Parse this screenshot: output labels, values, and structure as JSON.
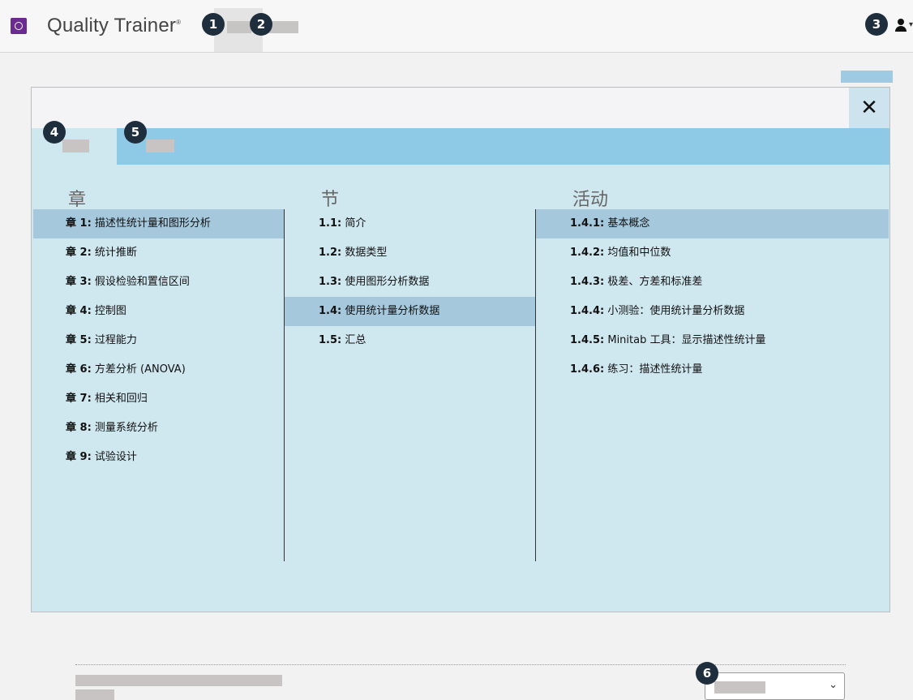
{
  "header": {
    "app_name": "Quality Trainer",
    "registered_mark": "®"
  },
  "callouts": [
    "1",
    "2",
    "3",
    "4",
    "5",
    "6"
  ],
  "icons": {
    "logo": "play-circle-icon",
    "user": "user-icon",
    "close": "close-icon",
    "dropdown": "chevron-down-icon"
  },
  "panel": {
    "close_label": "✕",
    "columns": {
      "chapters": {
        "heading": "章",
        "items": [
          {
            "num": "章 1:",
            "text": " 描述性统计量和图形分析",
            "selected": true
          },
          {
            "num": "章 2:",
            "text": " 统计推断",
            "selected": false
          },
          {
            "num": "章 3:",
            "text": " 假设检验和置信区间",
            "selected": false
          },
          {
            "num": "章 4:",
            "text": " 控制图",
            "selected": false
          },
          {
            "num": "章 5:",
            "text": " 过程能力",
            "selected": false
          },
          {
            "num": "章 6:",
            "text": " 方差分析 (ANOVA)",
            "selected": false
          },
          {
            "num": "章 7:",
            "text": " 相关和回归",
            "selected": false
          },
          {
            "num": "章 8:",
            "text": " 测量系统分析",
            "selected": false
          },
          {
            "num": "章 9:",
            "text": " 试验设计",
            "selected": false
          }
        ]
      },
      "sections": {
        "heading": "节",
        "items": [
          {
            "num": "1.1:",
            "text": " 简介",
            "selected": false
          },
          {
            "num": "1.2:",
            "text": " 数据类型",
            "selected": false
          },
          {
            "num": "1.3:",
            "text": " 使用图形分析数据",
            "selected": false
          },
          {
            "num": "1.4:",
            "text": " 使用统计量分析数据",
            "selected": true
          },
          {
            "num": "1.5:",
            "text": " 汇总",
            "selected": false
          }
        ]
      },
      "activities": {
        "heading": "活动",
        "items": [
          {
            "num": "1.4.1:",
            "text": " 基本概念",
            "selected": true
          },
          {
            "num": "1.4.2:",
            "text": " 均值和中位数",
            "selected": false
          },
          {
            "num": "1.4.3:",
            "text": " 极差、方差和标准差",
            "selected": false
          },
          {
            "num": "1.4.4:",
            "text": " 小测验：使用统计量分析数据",
            "selected": false
          },
          {
            "num": "1.4.5:",
            "text": " Minitab 工具：显示描述性统计量",
            "selected": false
          },
          {
            "num": "1.4.6:",
            "text": " 练习：描述性统计量",
            "selected": false
          }
        ]
      }
    }
  },
  "colors": {
    "brand": "#6b2c91",
    "tabbar": "#8ecae6",
    "panel_bg": "#cfe7ef",
    "selected_row": "#a5c8dc",
    "callout": "#1f2e3d"
  }
}
